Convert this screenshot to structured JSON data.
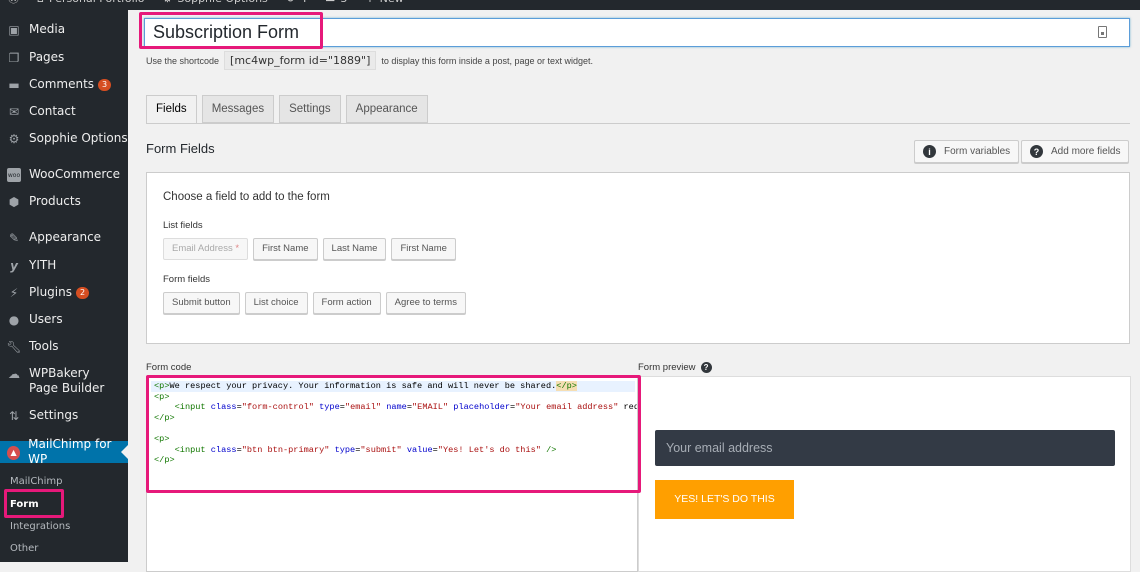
{
  "admin_bar": {
    "items": [
      {
        "icon": "wordpress-icon",
        "label": ""
      },
      {
        "icon": "home-icon",
        "label": "Personal Portfolio"
      },
      {
        "icon": "gear-icon",
        "label": "Sopphie Options"
      },
      {
        "icon": "updates-icon",
        "label": "4"
      },
      {
        "icon": "comment-icon",
        "label": "3"
      },
      {
        "icon": "plus-icon",
        "label": "New"
      }
    ]
  },
  "sidebar": {
    "items": [
      {
        "label": "Media",
        "icon": "media-icon"
      },
      {
        "label": "Pages",
        "icon": "pages-icon"
      },
      {
        "label": "Comments",
        "icon": "comments-icon",
        "badge": "3"
      },
      {
        "label": "Contact",
        "icon": "envelope-icon"
      },
      {
        "label": "Sopphie Options",
        "icon": "gear-icon"
      },
      {
        "label": "WooCommerce",
        "icon": "woocommerce-icon"
      },
      {
        "label": "Products",
        "icon": "box-icon"
      },
      {
        "label": "Appearance",
        "icon": "paintbrush-icon"
      },
      {
        "label": "YITH",
        "icon": "yith-icon"
      },
      {
        "label": "Plugins",
        "icon": "plug-icon",
        "badge": "2"
      },
      {
        "label": "Users",
        "icon": "user-icon"
      },
      {
        "label": "Tools",
        "icon": "wrench-icon"
      },
      {
        "label": "WPBakery Page Builder",
        "icon": "cloud-icon"
      },
      {
        "label": "Settings",
        "icon": "sliders-icon"
      },
      {
        "label": "MailChimp for WP",
        "icon": "mailchimp-icon",
        "current": true
      }
    ],
    "submenu": [
      {
        "label": "MailChimp"
      },
      {
        "label": "Form",
        "current": true
      },
      {
        "label": "Integrations"
      },
      {
        "label": "Other"
      }
    ]
  },
  "form": {
    "title": "Subscription Form",
    "shortcode_prefix": "Use the shortcode",
    "shortcode": "[mc4wp_form id=\"1889\"]",
    "shortcode_suffix": "to display this form inside a post, page or text widget."
  },
  "tabs": [
    {
      "label": "Fields",
      "active": true
    },
    {
      "label": "Messages"
    },
    {
      "label": "Settings"
    },
    {
      "label": "Appearance"
    }
  ],
  "form_fields": {
    "title": "Form Fields",
    "form_variables_label": "Form variables",
    "add_more_fields_label": "Add more fields",
    "choose_label": "Choose a field to add to the form",
    "list_fields_label": "List fields",
    "list_fields": [
      {
        "label": "Email Address",
        "required_mark": "*",
        "disabled": true
      },
      {
        "label": "First Name"
      },
      {
        "label": "Last Name"
      },
      {
        "label": "First Name"
      }
    ],
    "form_fields_label": "Form fields",
    "form_fields": [
      {
        "label": "Submit button"
      },
      {
        "label": "List choice"
      },
      {
        "label": "Form action"
      },
      {
        "label": "Agree to terms"
      }
    ]
  },
  "form_code": {
    "label": "Form code",
    "lines": [
      "<p>We respect your privacy. Your information is safe and will never be shared.</p>",
      "<p>",
      "    <input class=\"form-control\" type=\"email\" name=\"EMAIL\" placeholder=\"Your email address\" required />",
      "</p>",
      "",
      "<p>",
      "    <input class=\"btn btn-primary\" type=\"submit\" value=\"Yes! Let's do this\" />",
      "</p>"
    ]
  },
  "form_preview": {
    "label": "Form preview",
    "email_placeholder": "Your email address",
    "submit_label": "YES! LET'S DO THIS"
  },
  "colors": {
    "accent_blue": "#0073aa",
    "highlight_pink": "#e6197a",
    "preview_button": "#ff9f00",
    "preview_input": "#333a45"
  }
}
